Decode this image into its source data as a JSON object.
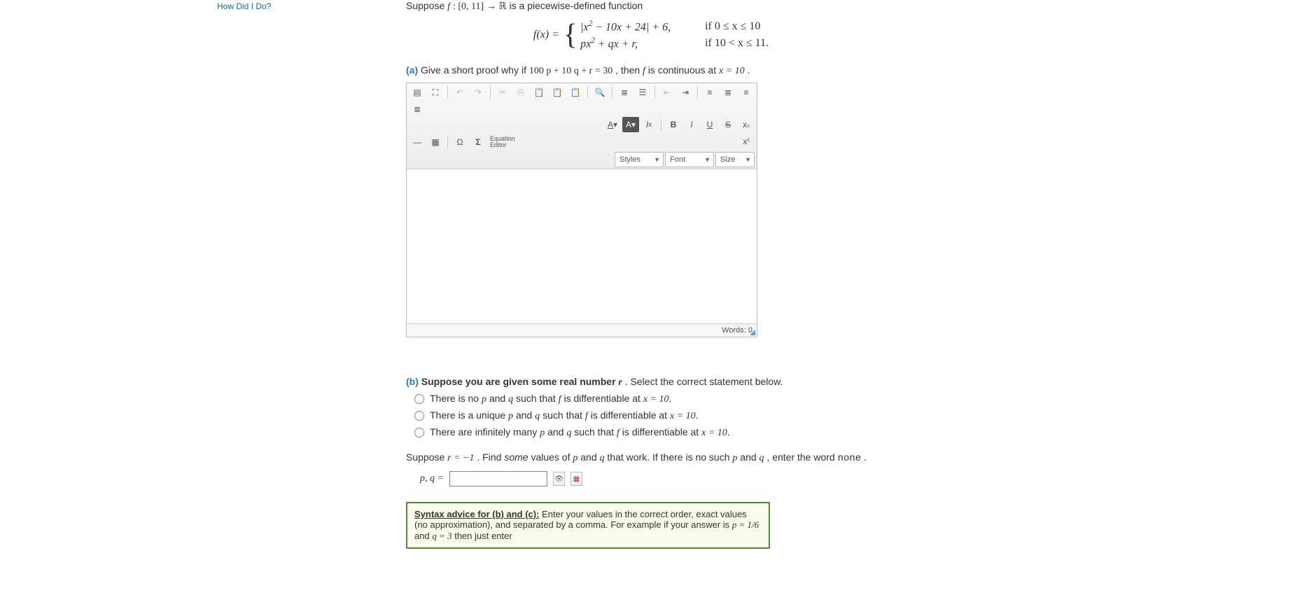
{
  "sidebar": {
    "how_did_i_do": "How Did I Do?"
  },
  "problem": {
    "intro_prefix": "Suppose ",
    "intro_fdecl_f": "f",
    "intro_fdecl_colon": " : ",
    "intro_fdecl_dom": "[0, 11]",
    "intro_fdecl_arrow": " → ",
    "intro_fdecl_R": "ℝ",
    "intro_suffix": " is a piecewise-defined function",
    "fx_lhs": "f(x) = ",
    "pieces": [
      {
        "expr": "|x² − 10x + 24| + 6,",
        "cond": "if 0 ≤ x ≤ 10"
      },
      {
        "expr": "px² + qx + r,",
        "cond": "if 10 < x ≤ 11."
      }
    ]
  },
  "part_a": {
    "label": "(a)",
    "text_prefix": " Give a short proof why if ",
    "eq1": "100 p + 10 q + r = 30",
    "text_mid": ", then ",
    "f": "f",
    "text_mid2": " is continuous at ",
    "x": "x = 10",
    "period": "."
  },
  "rte": {
    "row2_left": {
      "eq_editor_top": "Equation",
      "eq_editor_bottom": "Editor"
    },
    "row2_right": {
      "styles": "Styles",
      "font": "Font",
      "size": "Size"
    },
    "footer": {
      "words_label": "Words: ",
      "words_count": "0"
    }
  },
  "part_b": {
    "label": "(b)",
    "bold_text": " Suppose you are given some real number ",
    "r": "r",
    "after_r": ". Select the correct statement below.",
    "options": [
      {
        "pre": "There is no ",
        "p": "p",
        "mid1": " and ",
        "q": "q",
        "mid2": " such that ",
        "f": "f",
        "mid3": " is differentiable at ",
        "x": "x = 10",
        "end": "."
      },
      {
        "pre": "There is a unique ",
        "p": "p",
        "mid1": " and ",
        "q": "q",
        "mid2": " such that ",
        "f": "f",
        "mid3": " is differentiable at ",
        "x": "x = 10",
        "end": "."
      },
      {
        "pre": "There are infinitely many ",
        "p": "p",
        "mid1": " and ",
        "q": "q",
        "mid2": " such that ",
        "f": "f",
        "mid3": " is differentiable at ",
        "x": "x = 10",
        "end": "."
      }
    ]
  },
  "suppose_r": {
    "prefix": "Suppose ",
    "req": "r = −1",
    "mid1": ". Find ",
    "some": "some",
    "mid2": " values of ",
    "p": "p",
    "mid3": " and ",
    "q": "q",
    "mid4": " that work. If there is no such ",
    "p2": "p",
    "mid5": " and ",
    "q2": "q",
    "mid6": ", enter the word ",
    "none": "none",
    "period": ".",
    "pq_lhs": "p, q ="
  },
  "advice": {
    "title": "Syntax advice for (b) and (c):",
    "body1": "  Enter your values in the correct order, exact values (no approximation), and separated by a comma. For example if your answer is ",
    "ex_p": "p = 1/6",
    "and": " and ",
    "ex_q": "q = 3",
    "body2": " then just enter"
  }
}
